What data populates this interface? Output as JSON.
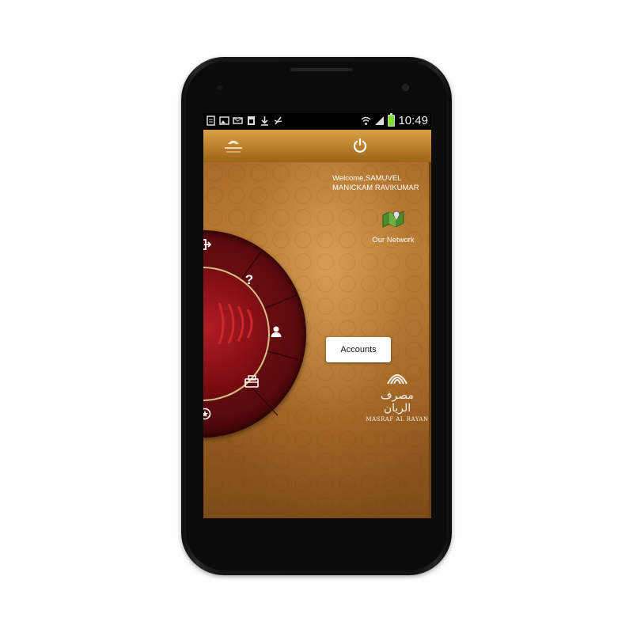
{
  "status_bar": {
    "time": "10:49",
    "left_icons": [
      "document-icon",
      "image-icon",
      "mail-icon",
      "sim-icon",
      "download-icon",
      "usb-icon"
    ],
    "right_icons": [
      "wifi-icon",
      "signal-icon",
      "battery-icon"
    ],
    "battery_color": "#7fe030"
  },
  "app_bar": {
    "logo_icon": "masraf-al-rayan-logo",
    "action_icon": "power-icon",
    "colors": {
      "bar_top": "#d9a24a",
      "bar_bottom": "#9c6419"
    }
  },
  "main": {
    "welcome_text": "Welcome,SAMUVEL MANICKAM RAVIKUMAR",
    "network": {
      "label": "Our Network",
      "icon": "map-icon"
    },
    "tooltip": {
      "text": "Accounts"
    },
    "brand": {
      "arabic": "مصرف الريان",
      "latin": "MASRAF AL RAYAN"
    },
    "wheel_items": [
      {
        "name": "logout-icon",
        "symbol": "⇥"
      },
      {
        "name": "help-icon",
        "symbol": "?"
      },
      {
        "name": "accounts-icon",
        "symbol": "person"
      },
      {
        "name": "transfer-icon",
        "symbol": "card"
      },
      {
        "name": "favorites-icon",
        "symbol": "star"
      }
    ],
    "colors": {
      "wheel_outer": "#5a0a0d",
      "wheel_inner": "#b01d22",
      "ring": "#d8c08a",
      "text": "#ffffff"
    }
  }
}
